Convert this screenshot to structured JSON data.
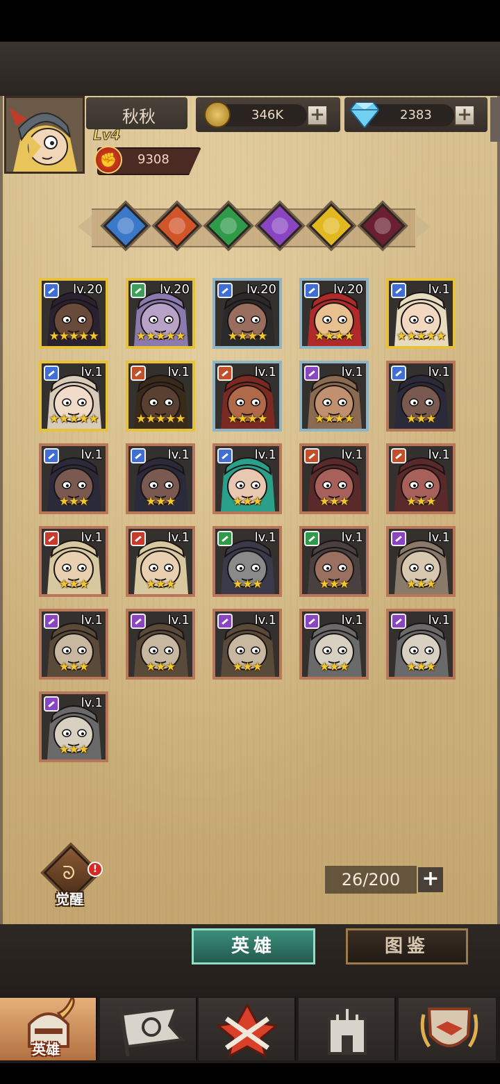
{
  "player": {
    "name": "秋秋",
    "level": "Lv4",
    "power": "9308",
    "avatar_icon": "knight-girl-portrait"
  },
  "resources": {
    "gold": "346K",
    "gems": "2383"
  },
  "element_filters": [
    {
      "name": "light-element",
      "color": "#3a78c8"
    },
    {
      "name": "fire-element",
      "color": "#d2552a"
    },
    {
      "name": "nature-element",
      "color": "#2f9a4a"
    },
    {
      "name": "arcane-element",
      "color": "#8a45c2"
    },
    {
      "name": "holy-element",
      "color": "#e2b820"
    },
    {
      "name": "dark-element",
      "color": "#6a2030"
    }
  ],
  "heroes": [
    {
      "level": "lv.20",
      "stars": "★★★★★",
      "rarity": "gold",
      "class_color": "#3f6fd6",
      "skin": "#6a4a3a",
      "hair": "#2a2230"
    },
    {
      "level": "lv.20",
      "stars": "★★★★★",
      "rarity": "gold",
      "class_color": "#3aa05a",
      "skin": "#b9a2c8",
      "hair": "#8a7ab0"
    },
    {
      "level": "lv.20",
      "stars": "★★★★",
      "rarity": "blue",
      "class_color": "#3f6fd6",
      "skin": "#9a6e5e",
      "hair": "#2a2a2a"
    },
    {
      "level": "lv.20",
      "stars": "★★★★",
      "rarity": "blue",
      "class_color": "#3f6fd6",
      "skin": "#e8c090",
      "hair": "#b02a2a"
    },
    {
      "level": "lv.1",
      "stars": "★★★★★",
      "rarity": "gold",
      "class_color": "#3f6fd6",
      "skin": "#f2d8c0",
      "hair": "#e8dcc0"
    },
    {
      "level": "lv.1",
      "stars": "★★★★★",
      "rarity": "gold",
      "class_color": "#3f6fd6",
      "skin": "#f0dcc8",
      "hair": "#d8ccb8"
    },
    {
      "level": "lv.1",
      "stars": "★★★★★",
      "rarity": "gold",
      "class_color": "#c2502a",
      "skin": "#5a4030",
      "hair": "#3a2a1a"
    },
    {
      "level": "lv.1",
      "stars": "★★★★",
      "rarity": "blue",
      "class_color": "#c2502a",
      "skin": "#b06a4a",
      "hair": "#7a2a20"
    },
    {
      "level": "lv.1",
      "stars": "★★★★",
      "rarity": "blue",
      "class_color": "#8a45c2",
      "skin": "#c09070",
      "hair": "#8a6a50"
    },
    {
      "level": "lv.1",
      "stars": "★★★",
      "rarity": "copper",
      "class_color": "#3f6fd6",
      "skin": "#7a5a50",
      "hair": "#2a2a3a"
    },
    {
      "level": "lv.1",
      "stars": "★★★",
      "rarity": "copper",
      "class_color": "#3f6fd6",
      "skin": "#7a5a50",
      "hair": "#2a2a3a"
    },
    {
      "level": "lv.1",
      "stars": "★★★",
      "rarity": "copper",
      "class_color": "#3f6fd6",
      "skin": "#7a5a50",
      "hair": "#2a2a3a"
    },
    {
      "level": "lv.1",
      "stars": "★★★",
      "rarity": "copper",
      "class_color": "#3f6fd6",
      "skin": "#e8c8b0",
      "hair": "#2aa08a"
    },
    {
      "level": "lv.1",
      "stars": "★★★",
      "rarity": "copper",
      "class_color": "#c2502a",
      "skin": "#a8605a",
      "hair": "#5a2a2a"
    },
    {
      "level": "lv.1",
      "stars": "★★★",
      "rarity": "copper",
      "class_color": "#c2502a",
      "skin": "#a8605a",
      "hair": "#5a2a2a"
    },
    {
      "level": "lv.1",
      "stars": "★★★",
      "rarity": "copper",
      "class_color": "#c83a2a",
      "skin": "#e8d0b0",
      "hair": "#d8c8a0"
    },
    {
      "level": "lv.1",
      "stars": "★★★",
      "rarity": "copper",
      "class_color": "#c83a2a",
      "skin": "#e8d0b0",
      "hair": "#d8c8a0"
    },
    {
      "level": "lv.1",
      "stars": "★★★",
      "rarity": "copper",
      "class_color": "#2f9a4a",
      "skin": "#8a8a8a",
      "hair": "#3a3a4a"
    },
    {
      "level": "lv.1",
      "stars": "★★★",
      "rarity": "copper",
      "class_color": "#2f9a4a",
      "skin": "#9a7060",
      "hair": "#4a4040"
    },
    {
      "level": "lv.1",
      "stars": "★★★",
      "rarity": "copper",
      "class_color": "#8a45c2",
      "skin": "#d8c8b0",
      "hair": "#8a7a6a"
    },
    {
      "level": "lv.1",
      "stars": "★★★",
      "rarity": "copper",
      "class_color": "#8a45c2",
      "skin": "#c8b8a0",
      "hair": "#5a4a3a"
    },
    {
      "level": "lv.1",
      "stars": "★★★",
      "rarity": "copper",
      "class_color": "#8a45c2",
      "skin": "#c8b8a0",
      "hair": "#5a4a3a"
    },
    {
      "level": "lv.1",
      "stars": "★★★",
      "rarity": "copper",
      "class_color": "#8a45c2",
      "skin": "#c8b8a0",
      "hair": "#5a4a3a"
    },
    {
      "level": "lv.1",
      "stars": "★★★",
      "rarity": "copper",
      "class_color": "#8a45c2",
      "skin": "#d8d0c0",
      "hair": "#6a6a6a"
    },
    {
      "level": "lv.1",
      "stars": "★★★",
      "rarity": "copper",
      "class_color": "#8a45c2",
      "skin": "#d8d0c0",
      "hair": "#6a6a6a"
    },
    {
      "level": "lv.1",
      "stars": "★★★",
      "rarity": "copper",
      "class_color": "#8a45c2",
      "skin": "#d8d0c0",
      "hair": "#6a6a6a"
    }
  ],
  "awaken": {
    "label": "觉醒",
    "alert": "!"
  },
  "capacity": {
    "value": "26/200",
    "plus": "+"
  },
  "tabs": {
    "heroes": "英雄",
    "codex": "图鉴"
  },
  "nav": [
    {
      "name": "nav-heroes",
      "label": "英雄",
      "icon": "helmet-icon",
      "active": true
    },
    {
      "name": "nav-adventure",
      "label": "",
      "icon": "banner-icon",
      "active": false
    },
    {
      "name": "nav-battle",
      "label": "",
      "icon": "crossed-swords-icon",
      "active": false
    },
    {
      "name": "nav-castle",
      "label": "",
      "icon": "castle-icon",
      "active": false
    },
    {
      "name": "nav-guild",
      "label": "",
      "icon": "handshake-shield-icon",
      "active": false
    }
  ]
}
